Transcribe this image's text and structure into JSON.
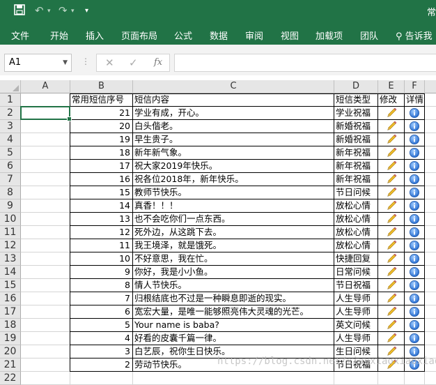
{
  "app": {
    "title_fragment": "常",
    "accent": "#217346"
  },
  "ribbon": {
    "tabs": [
      "文件",
      "开始",
      "插入",
      "页面布局",
      "公式",
      "数据",
      "审阅",
      "视图",
      "加载项",
      "团队"
    ],
    "tell_me": "告诉我"
  },
  "formula_bar": {
    "name_box": "A1",
    "fx": "fx",
    "value": ""
  },
  "columns": [
    "A",
    "B",
    "C",
    "D",
    "E",
    "F"
  ],
  "headers": {
    "seq": "常用短信序号",
    "content": "短信内容",
    "type": "短信类型",
    "edit": "修改",
    "detail": "详情"
  },
  "rows": [
    {
      "row": "1"
    },
    {
      "row": "2",
      "seq": "21",
      "content": "学业有成，开心。",
      "type": "学业祝福"
    },
    {
      "row": "3",
      "seq": "20",
      "content": "白头偕老。",
      "type": "新婚祝福"
    },
    {
      "row": "4",
      "seq": "19",
      "content": "早生贵子。",
      "type": "新婚祝福"
    },
    {
      "row": "5",
      "seq": "18",
      "content": "新年新气象。",
      "type": "新年祝福"
    },
    {
      "row": "6",
      "seq": "17",
      "content": "祝大家2019年快乐。",
      "type": "新年祝福"
    },
    {
      "row": "7",
      "seq": "16",
      "content": "祝各位2018年，新年快乐。",
      "type": "新年祝福"
    },
    {
      "row": "8",
      "seq": "15",
      "content": "教师节快乐。",
      "type": "节日问候"
    },
    {
      "row": "9",
      "seq": "14",
      "content": "真香！！！",
      "type": "放松心情"
    },
    {
      "row": "10",
      "seq": "13",
      "content": "也不会吃你们一点东西。",
      "type": "放松心情"
    },
    {
      "row": "11",
      "seq": "12",
      "content": "死外边，从这跳下去。",
      "type": "放松心情"
    },
    {
      "row": "12",
      "seq": "11",
      "content": "我王境泽，就是饿死。",
      "type": "放松心情"
    },
    {
      "row": "13",
      "seq": "10",
      "content": "不好意思，我在忙。",
      "type": "快捷回复"
    },
    {
      "row": "14",
      "seq": "9",
      "content": "你好，我是小小鱼。",
      "type": "日常问候"
    },
    {
      "row": "15",
      "seq": "8",
      "content": "情人节快乐。",
      "type": "节日祝福"
    },
    {
      "row": "16",
      "seq": "7",
      "content": "归根结底也不过是一种瞬息即逝的现实。",
      "type": "人生导师"
    },
    {
      "row": "17",
      "seq": "6",
      "content": "宽宏大量，是唯一能够照亮伟大灵魂的光芒。",
      "type": "人生导师"
    },
    {
      "row": "18",
      "seq": "5",
      "content": "Your name is baba?",
      "type": "英文问候"
    },
    {
      "row": "19",
      "seq": "4",
      "content": "好看的皮囊千篇一律。",
      "type": "人生导师"
    },
    {
      "row": "20",
      "seq": "3",
      "content": "白艺辰，祝你生日快乐。",
      "type": "生日问候"
    },
    {
      "row": "21",
      "seq": "2",
      "content": "劳动节快乐。",
      "type": "节日祝福"
    },
    {
      "row": "22"
    }
  ],
  "watermark": "https://blog.csdn.net/xiaoxiaoxiaoxiaoyu"
}
